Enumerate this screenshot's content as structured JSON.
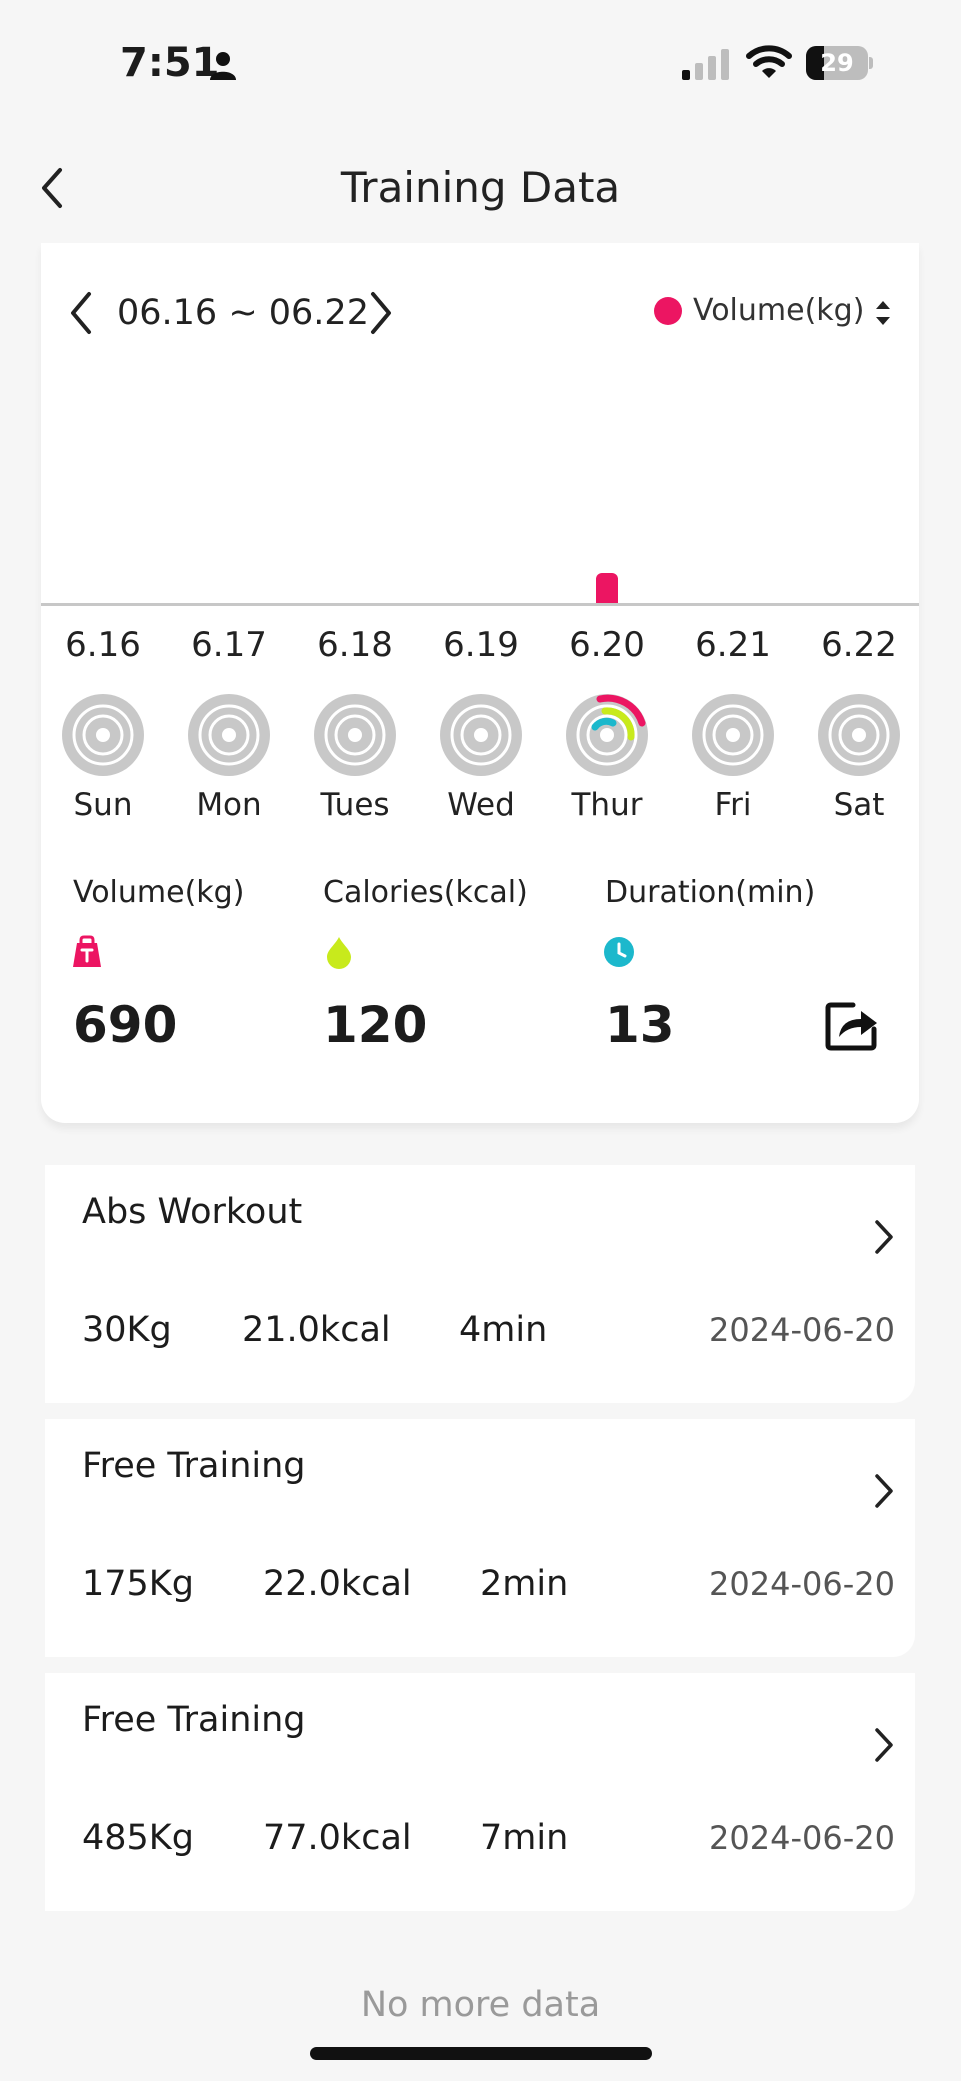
{
  "status_bar": {
    "time": "7:51",
    "battery_level": 29,
    "battery_text": "29"
  },
  "nav": {
    "title": "Training Data"
  },
  "summary": {
    "week_range": "06.16 ~ 06.22",
    "metric_label": "Volume(kg)",
    "accent_color": "#ec1562",
    "chart_data": {
      "type": "bar",
      "categories": [
        "6.16",
        "6.17",
        "6.18",
        "6.19",
        "6.20",
        "6.21",
        "6.22"
      ],
      "values": [
        0,
        0,
        0,
        0,
        690,
        0,
        0
      ],
      "ylim": [
        0,
        5500
      ],
      "grid": false
    },
    "days": [
      {
        "date": "6.16",
        "weekday": "Sun",
        "has_data": false
      },
      {
        "date": "6.17",
        "weekday": "Mon",
        "has_data": false
      },
      {
        "date": "6.18",
        "weekday": "Tues",
        "has_data": false
      },
      {
        "date": "6.19",
        "weekday": "Wed",
        "has_data": false
      },
      {
        "date": "6.20",
        "weekday": "Thur",
        "has_data": true
      },
      {
        "date": "6.21",
        "weekday": "Fri",
        "has_data": false
      },
      {
        "date": "6.22",
        "weekday": "Sat",
        "has_data": false
      }
    ],
    "stats": [
      {
        "label": "Volume(kg)",
        "value": "690",
        "icon": "kettlebell-icon",
        "color": "#ec1562"
      },
      {
        "label": "Calories(kcal)",
        "value": "120",
        "icon": "flame-drop-icon",
        "color": "#c8ea1c"
      },
      {
        "label": "Duration(min)",
        "value": "13",
        "icon": "clock-icon",
        "color": "#1cb8cc"
      }
    ]
  },
  "records": [
    {
      "title": "Abs Workout",
      "volume": "30Kg",
      "calories": "21.0kcal",
      "duration": "4min",
      "date": "2024-06-20"
    },
    {
      "title": "Free Training",
      "volume": "175Kg",
      "calories": "22.0kcal",
      "duration": "2min",
      "date": "2024-06-20"
    },
    {
      "title": "Free Training",
      "volume": "485Kg",
      "calories": "77.0kcal",
      "duration": "7min",
      "date": "2024-06-20"
    }
  ],
  "footer": {
    "no_more": "No more data"
  }
}
